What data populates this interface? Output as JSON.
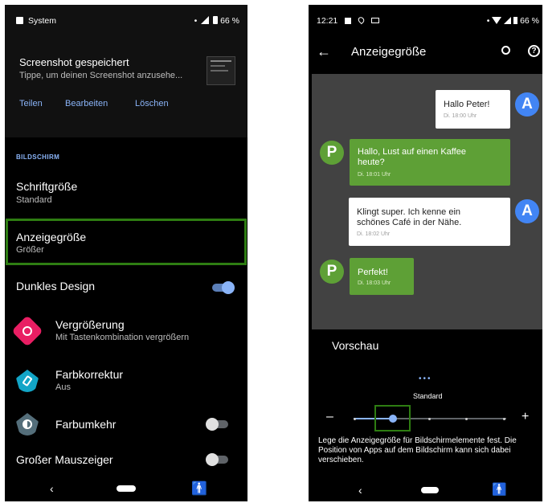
{
  "left": {
    "status": {
      "app": "System",
      "battery": "66 %"
    },
    "notification": {
      "title": "Screenshot gespeichert",
      "text": "Tippe, um deinen Screenshot anzusehe...",
      "actions": [
        "Teilen",
        "Bearbeiten",
        "Löschen"
      ]
    },
    "section_header": "BILDSCHIRM",
    "settings": [
      {
        "title": "Schriftgröße",
        "subtitle": "Standard"
      },
      {
        "title": "Anzeigegröße",
        "subtitle": "Größer"
      },
      {
        "title": "Dunkles Design"
      },
      {
        "title": "Vergrößerung",
        "subtitle": "Mit Tastenkombination vergrößern"
      },
      {
        "title": "Farbkorrektur",
        "subtitle": "Aus"
      },
      {
        "title": "Farbumkehr"
      },
      {
        "title": "Großer Mauszeiger"
      }
    ],
    "toggles": {
      "dark_design": true,
      "color_inversion": false,
      "large_cursor": false
    }
  },
  "right": {
    "status": {
      "time": "12:21",
      "battery": "66 %"
    },
    "toolbar": {
      "title": "Anzeigegröße"
    },
    "preview": [
      {
        "avatar": "A",
        "text": "Hallo Peter!",
        "time": "Di. 18:00 Uhr"
      },
      {
        "avatar": "P",
        "text": "Hallo, Lust auf einen Kaffee heute?",
        "time": "Di. 18:01 Uhr"
      },
      {
        "avatar": "A",
        "text": "Klingt super. Ich kenne ein schönes Café in der Nähe.",
        "time": "Di. 18:02 Uhr"
      },
      {
        "avatar": "P",
        "text": "Perfekt!",
        "time": "Di. 18:03 Uhr"
      }
    ],
    "preview_label": "Vorschau",
    "size_label": "Standard",
    "minus": "–",
    "plus": "+",
    "description": "Lege die Anzeigegröße für Bildschirmelemente fest. Die Position von Apps auf dem Bildschirm kann sich dabei verschieben."
  },
  "colors": {
    "accent_blue": "#8ab4f8",
    "highlight_green": "#2e7d12",
    "bubble_green": "#5ea036",
    "avatar_blue": "#4285f4",
    "avatar_green": "#5ea036"
  }
}
